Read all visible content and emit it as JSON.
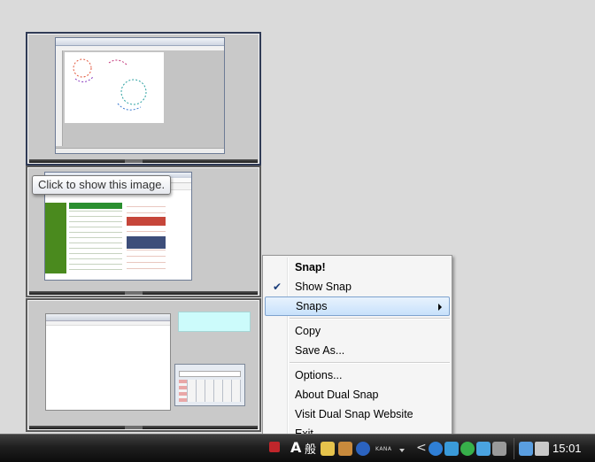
{
  "tooltip": {
    "text": "Click to show this image."
  },
  "snaps": [
    {
      "name": "paint-snapshot"
    },
    {
      "name": "browser-snapshot"
    },
    {
      "name": "notepad-calculator-snapshot"
    }
  ],
  "context_menu": {
    "items": [
      {
        "label": "Snap!",
        "bold": true
      },
      {
        "label": "Show Snap",
        "checked": true
      },
      {
        "label": "Snaps",
        "submenu": true,
        "highlighted": true
      },
      {
        "label": "Copy"
      },
      {
        "label": "Save As..."
      },
      {
        "label": "Options..."
      },
      {
        "label": "About Dual Snap"
      },
      {
        "label": "Visit Dual Snap Website"
      },
      {
        "label": "Exit"
      }
    ]
  },
  "taskbar": {
    "ime_mode": "A",
    "ime_kanji": "般",
    "kana_label": "KANA",
    "show_hidden_glyph": "<",
    "clock": "15:01"
  },
  "icons": {
    "check": "✔",
    "tray": [
      "red-snap-icon",
      "ime-pad-icon",
      "briefcase-icon",
      "help-icon",
      "pen-icon",
      "blue-refresh-icon",
      "network-icon",
      "shield-check-icon",
      "dropbox-icon",
      "windows-flag-icon",
      "display-icon",
      "speaker-icon"
    ]
  },
  "colors": {
    "menu_highlight_border": "#7da2ce",
    "tooltip_border": "#767676",
    "taskbar": "#1f1f1f",
    "cyan_note": "#ccfbfb"
  }
}
